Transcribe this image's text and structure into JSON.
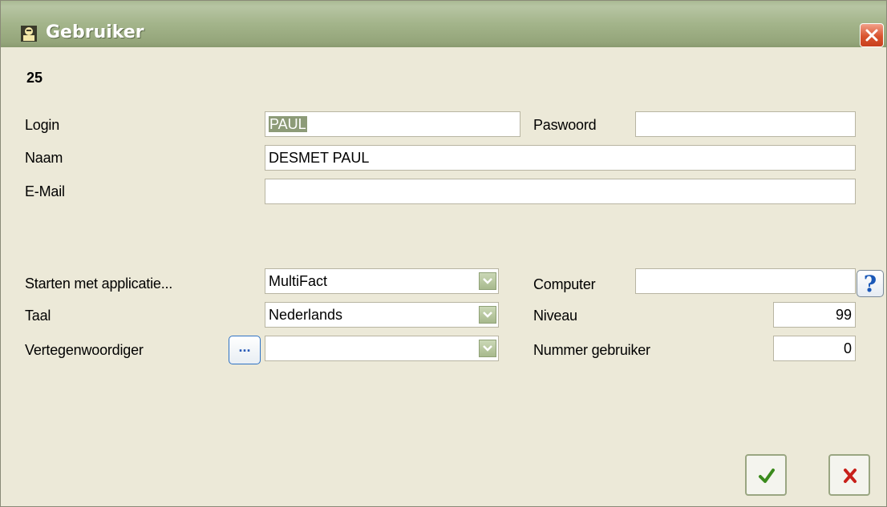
{
  "window": {
    "title": "Gebruiker",
    "title_icon": "user-icon",
    "close_icon": "close-icon"
  },
  "record_id": "25",
  "form": {
    "login_label": "Login",
    "login_value": "PAUL",
    "password_label": "Paswoord",
    "password_value": "",
    "name_label": "Naam",
    "name_value": "DESMET PAUL",
    "email_label": "E-Mail",
    "email_value": "",
    "start_app_label": "Starten met applicatie...",
    "start_app_value": "MultiFact",
    "language_label": "Taal",
    "language_value": "Nederlands",
    "rep_label": "Vertegenwoordiger",
    "rep_value": "",
    "rep_lookup_label": "...",
    "computer_label": "Computer",
    "computer_value": "",
    "help_label": "?",
    "level_label": "Niveau",
    "level_value": "99",
    "user_number_label": "Nummer gebruiker",
    "user_number_value": "0"
  },
  "actions": {
    "ok_icon": "checkmark-icon",
    "cancel_icon": "x-mark-icon"
  },
  "colors": {
    "titlebar": "#a3b48a",
    "close": "#d9542f",
    "ok": "#3a8a1c",
    "cancel": "#c8201a",
    "help": "#1a58b8"
  }
}
